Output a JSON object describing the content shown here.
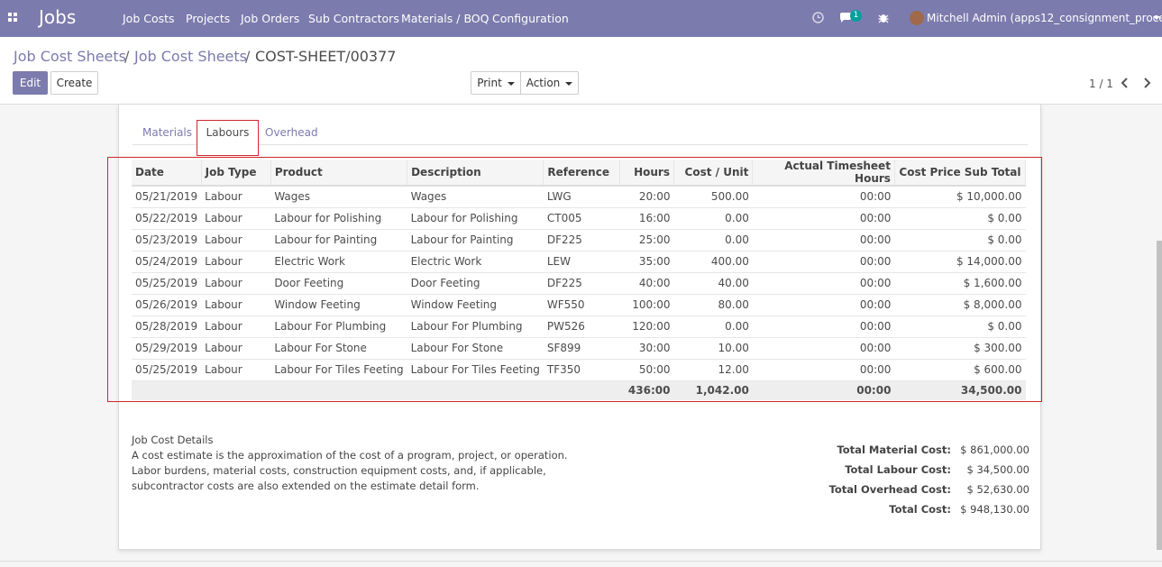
{
  "app": {
    "title": "Jobs"
  },
  "menu": [
    {
      "label": "Job Costs"
    },
    {
      "label": "Projects"
    },
    {
      "label": "Job Orders"
    },
    {
      "label": "Sub Contractors"
    },
    {
      "label": "Materials / BOQ"
    },
    {
      "label": "Configuration"
    }
  ],
  "systray": {
    "messages_count": "1",
    "user": "Mitchell Admin (apps12_consignment_process)"
  },
  "breadcrumb": {
    "item1": "Job Cost Sheets",
    "item2": "Job Cost Sheets",
    "current": "COST-SHEET/00377",
    "separator": "/"
  },
  "buttons": {
    "edit": "Edit",
    "create": "Create",
    "print": "Print",
    "action": "Action"
  },
  "pager": {
    "text": "1 / 1"
  },
  "tabs": {
    "materials": "Materials",
    "labours": "Labours",
    "overhead": "Overhead"
  },
  "table": {
    "headers": [
      "Date",
      "Job Type",
      "Product",
      "Description",
      "Reference",
      "Hours",
      "Cost / Unit",
      "Actual Timesheet Hours",
      "Cost Price Sub Total"
    ],
    "rows": [
      [
        "05/21/2019",
        "Labour",
        "Wages",
        "Wages",
        "LWG",
        "20:00",
        "500.00",
        "00:00",
        "$ 10,000.00"
      ],
      [
        "05/22/2019",
        "Labour",
        "Labour for Polishing",
        "Labour for Polishing",
        "CT005",
        "16:00",
        "0.00",
        "00:00",
        "$ 0.00"
      ],
      [
        "05/23/2019",
        "Labour",
        "Labour for Painting",
        "Labour for Painting",
        "DF225",
        "25:00",
        "0.00",
        "00:00",
        "$ 0.00"
      ],
      [
        "05/24/2019",
        "Labour",
        "Electric Work",
        "Electric Work",
        "LEW",
        "35:00",
        "400.00",
        "00:00",
        "$ 14,000.00"
      ],
      [
        "05/25/2019",
        "Labour",
        "Door Feeting",
        "Door Feeting",
        "DF225",
        "40:00",
        "40.00",
        "00:00",
        "$ 1,600.00"
      ],
      [
        "05/26/2019",
        "Labour",
        "Window Feeting",
        "Window Feeting",
        "WF550",
        "100:00",
        "80.00",
        "00:00",
        "$ 8,000.00"
      ],
      [
        "05/28/2019",
        "Labour",
        "Labour For Plumbing",
        "Labour For Plumbing",
        "PW526",
        "120:00",
        "0.00",
        "00:00",
        "$ 0.00"
      ],
      [
        "05/29/2019",
        "Labour",
        "Labour For Stone",
        "Labour For Stone",
        "SF899",
        "30:00",
        "10.00",
        "00:00",
        "$ 300.00"
      ],
      [
        "05/25/2019",
        "Labour",
        "Labour For Tiles Feeting",
        "Labour For Tiles Feeting",
        "TF350",
        "50:00",
        "12.00",
        "00:00",
        "$ 600.00"
      ]
    ],
    "footer": {
      "hours": "436:00",
      "cost_unit": "1,042.00",
      "timesheet": "00:00",
      "subtotal": "34,500.00"
    }
  },
  "details": {
    "title": "Job Cost Details",
    "line1": "A cost estimate is the approximation of the cost of a program, project, or operation.",
    "line2": "Labor burdens, material costs, construction equipment costs, and, if applicable,",
    "line3": "subcontractor costs are also extended on the estimate detail form."
  },
  "totals": {
    "material_label": "Total Material Cost:",
    "material_value": "$ 861,000.00",
    "labour_label": "Total Labour Cost:",
    "labour_value": "$ 34,500.00",
    "overhead_label": "Total Overhead Cost:",
    "overhead_value": "$ 52,630.00",
    "total_label": "Total Cost:",
    "total_value": "$ 948,130.00"
  },
  "colors": {
    "brand": "#7c7bad",
    "highlight": "#d0252b",
    "badge": "#00a09d"
  }
}
